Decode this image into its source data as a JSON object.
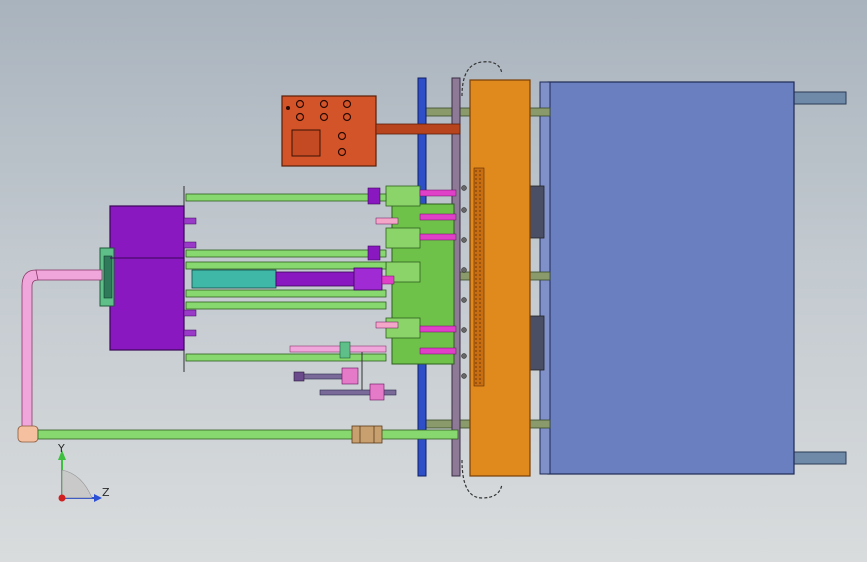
{
  "viewport": {
    "background_top": "#a9b3bd",
    "background_bottom": "#d9dcdd"
  },
  "triad": {
    "y_label": "Y",
    "z_label": "Z",
    "y_color": "#3fbf3f",
    "z_color": "#2b50d6",
    "x_color": "#d02020"
  },
  "colors": {
    "mold_block": "#6a7fbf",
    "orange_plate": "#e08a1e",
    "control_box": "#d4542a",
    "purple_housing": "#8a18c0",
    "green_rods": "#7ed36a",
    "pink_pipe": "#f0a6da",
    "magenta_tube": "#e040c8",
    "blue_plate": "#2e4fc7",
    "steel_rods": "#6f8aa8"
  },
  "icons": [
    "control-box-buttons",
    "coordinate-triad-icon"
  ]
}
